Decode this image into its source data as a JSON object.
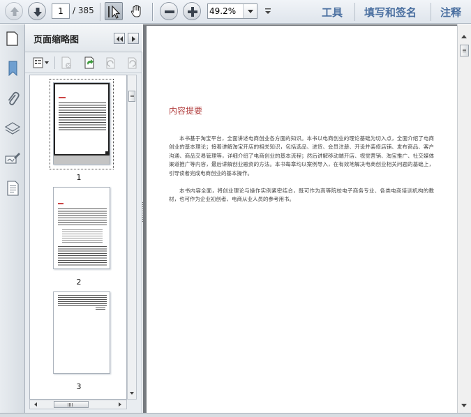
{
  "toolbar": {
    "prev_page_icon": "arrow-up-icon",
    "next_page_icon": "arrow-down-icon",
    "current_page": "1",
    "total_pages": "/ 385",
    "select_tool_icon": "cursor-arrow-icon",
    "hand_tool_icon": "hand-icon",
    "zoom_out_icon": "minus-icon",
    "zoom_in_icon": "plus-icon",
    "zoom_level": "49.2%",
    "tools_label": "工具",
    "fill_sign_label": "填写和签名",
    "comment_label": "注释"
  },
  "sidebar": {
    "panel_title": "页面缩略图",
    "thumbnails": [
      {
        "label": "1"
      },
      {
        "label": "2"
      },
      {
        "label": "3"
      }
    ]
  },
  "document": {
    "heading": "内容提要",
    "paragraphs": [
      "本书基于淘宝平台，全面讲述电商创业各方面的知识。本书以电商创业的理论基础为切入点，全面介绍了电商创业的基本理论；接着讲解淘宝开店的相关知识，包括选品、进货、会员注册、开设并装修店铺、发布商品、客户沟通、商品交易管理等，详细介绍了电商创业的基本流程；然后讲解移动端开店、视觉营销、淘宝推广、社交媒体渠道推广等内容，最后讲解创业融资的方法。本书每章均以案例导入，在有效地解决电商创业相关问题的基础上，引导读者完成电商创业的基本操作。",
      "本书内容全面，将创业理论与操作实例紧密结合，既可作为高等院校电子商务专业、各类电商培训机构的教材，也可作为企业初创者、电商从业人员的参考用书。"
    ]
  },
  "colors": {
    "accent_link": "#4a6fa0",
    "heading_red": "#b44444",
    "doc_background": "#767a7f"
  }
}
